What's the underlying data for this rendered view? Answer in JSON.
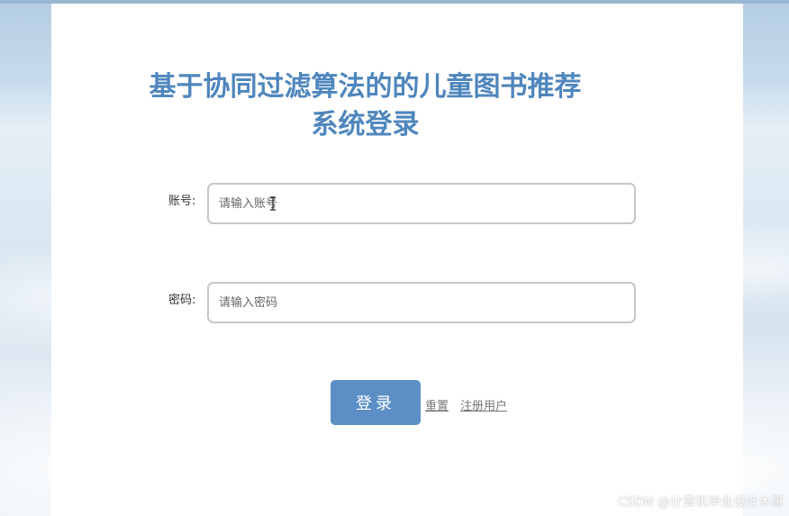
{
  "login": {
    "title_line1": "基于协同过滤算法的的儿童图书推荐",
    "title_line2": "系统登录",
    "account_label": "账号:",
    "account_placeholder": "请输入账号",
    "password_label": "密码:",
    "password_placeholder": "请输入密码",
    "login_button": "登录",
    "reset_link": "重置",
    "register_link": "注册用户"
  },
  "watermark": "CSDN @计算机毕业设计木哥",
  "colors": {
    "title": "#4f86bd",
    "button": "#5b8fc5"
  }
}
